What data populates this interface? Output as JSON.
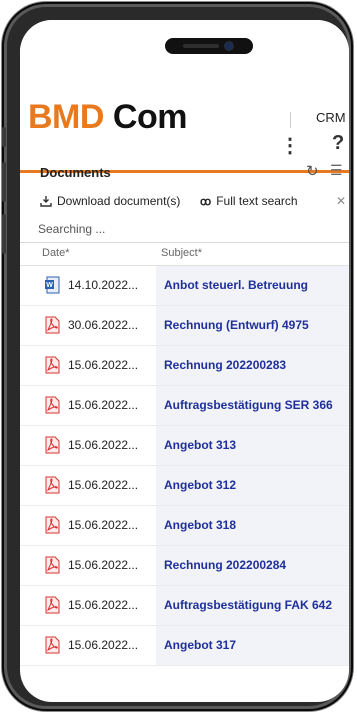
{
  "app": {
    "logo_part1": "BMD",
    "logo_part2": " Com",
    "crm_label": "CRM"
  },
  "colors": {
    "accent": "#e8791e",
    "link": "#1f2f9c",
    "row_highlight": "#f1f3f8"
  },
  "panel": {
    "title": "Documents",
    "download_label": "Download document(s)",
    "full_text_search_label": "Full text search",
    "search_value": "Searching ...",
    "columns": {
      "date": "Date*",
      "subject": "Subject*"
    }
  },
  "icons": {
    "menu": "kebab-menu-icon",
    "help": "help-icon",
    "refresh": "refresh-icon",
    "list": "list-icon",
    "download": "download-icon",
    "search": "binoculars-icon",
    "close": "close-icon"
  },
  "documents": [
    {
      "type": "word",
      "date": "14.10.2022...",
      "subject": "Anbot steuerl. Betreuung"
    },
    {
      "type": "pdf",
      "date": "30.06.2022...",
      "subject": "Rechnung (Entwurf) 4975"
    },
    {
      "type": "pdf",
      "date": "15.06.2022...",
      "subject": "Rechnung 202200283"
    },
    {
      "type": "pdf",
      "date": "15.06.2022...",
      "subject": "Auftragsbestätigung SER 366"
    },
    {
      "type": "pdf",
      "date": "15.06.2022...",
      "subject": "Angebot 313"
    },
    {
      "type": "pdf",
      "date": "15.06.2022...",
      "subject": "Angebot 312"
    },
    {
      "type": "pdf",
      "date": "15.06.2022...",
      "subject": "Angebot 318"
    },
    {
      "type": "pdf",
      "date": "15.06.2022...",
      "subject": "Rechnung 202200284"
    },
    {
      "type": "pdf",
      "date": "15.06.2022...",
      "subject": "Auftragsbestätigung FAK 642"
    },
    {
      "type": "pdf",
      "date": "15.06.2022...",
      "subject": "Angebot 317"
    }
  ]
}
